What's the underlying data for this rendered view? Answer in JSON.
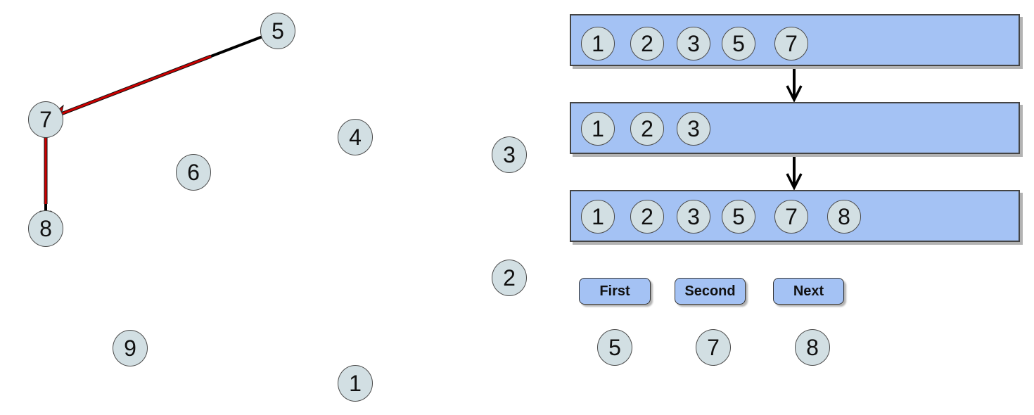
{
  "graph": {
    "nodes": [
      {
        "id": "5",
        "label": "5"
      },
      {
        "id": "7",
        "label": "7"
      },
      {
        "id": "8",
        "label": "8"
      },
      {
        "id": "6",
        "label": "6"
      },
      {
        "id": "4",
        "label": "4"
      },
      {
        "id": "3",
        "label": "3"
      },
      {
        "id": "2",
        "label": "2"
      },
      {
        "id": "9",
        "label": "9"
      },
      {
        "id": "1",
        "label": "1"
      }
    ],
    "edges": [
      {
        "from": "5",
        "to": "7",
        "highlight": "red"
      },
      {
        "from": "7",
        "to": "8",
        "highlight": "red"
      }
    ]
  },
  "sets": [
    {
      "items": [
        "1",
        "2",
        "3",
        "5",
        "7"
      ]
    },
    {
      "items": [
        "1",
        "2",
        "3"
      ]
    },
    {
      "items": [
        "1",
        "2",
        "3",
        "5",
        "7",
        "8"
      ]
    }
  ],
  "buttons": {
    "first": "First",
    "second": "Second",
    "next": "Next"
  },
  "button_values": {
    "first": "5",
    "second": "7",
    "next": "8"
  },
  "colors": {
    "node_fill": "#d2dfe3",
    "box_fill": "#a4c2f4",
    "highlight_edge": "#cc0000"
  }
}
